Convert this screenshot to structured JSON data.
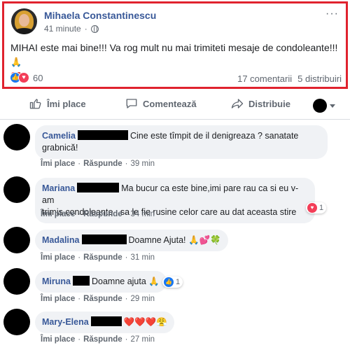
{
  "post": {
    "author": "Mihaela Constantinescu",
    "time": "41 minute",
    "dot": "·",
    "more": "···",
    "text": "MIHAI este mai bine!!! Va rog mult nu mai trimiteti mesaje de condoleante!!!",
    "text_emoji_1": "🙏",
    "text_emoji_2": "❤️",
    "reaction_count": "60",
    "comments": "17 comentarii",
    "shares": "5 distribuiri"
  },
  "actions": {
    "like": "Îmi place",
    "comment": "Comentează",
    "share": "Distribuie"
  },
  "comments": [
    {
      "name": "Camelia",
      "line1": "Cine este tîmpit de il denigreaza ? sanatate",
      "line2": "grabnică!",
      "like": "Îmi place",
      "reply": "Răspunde",
      "time": "39 min"
    },
    {
      "name": "Mariana",
      "line1": "Ma bucur ca este bine,imi pare rau ca si eu v-am",
      "line2": "trimis condoleante ..sa le fie rusine celor care au dat aceasta stire",
      "like": "Îmi place",
      "reply": "Răspunde",
      "time": "34 min",
      "reaction_count": "1"
    },
    {
      "name": "Madalina",
      "line1": "Doamne Ajuta!",
      "emoji": "🙏💕🍀",
      "like": "Îmi place",
      "reply": "Răspunde",
      "time": "31 min"
    },
    {
      "name": "Miruna",
      "line1": "Doamne ajuta",
      "emoji": "🙏",
      "like": "Îmi place",
      "reply": "Răspunde",
      "time": "29 min",
      "reaction_count": "1"
    },
    {
      "name": "Mary-Elena",
      "emoji": "❤️❤️❤️😤",
      "like": "Îmi place",
      "reply": "Răspunde",
      "time": "27 min"
    }
  ],
  "sep": "·",
  "colors": {
    "name_link": "#385898",
    "highlight_border": "#e0232e",
    "like_blue": "#1877f2",
    "love_red": "#f33e58"
  }
}
